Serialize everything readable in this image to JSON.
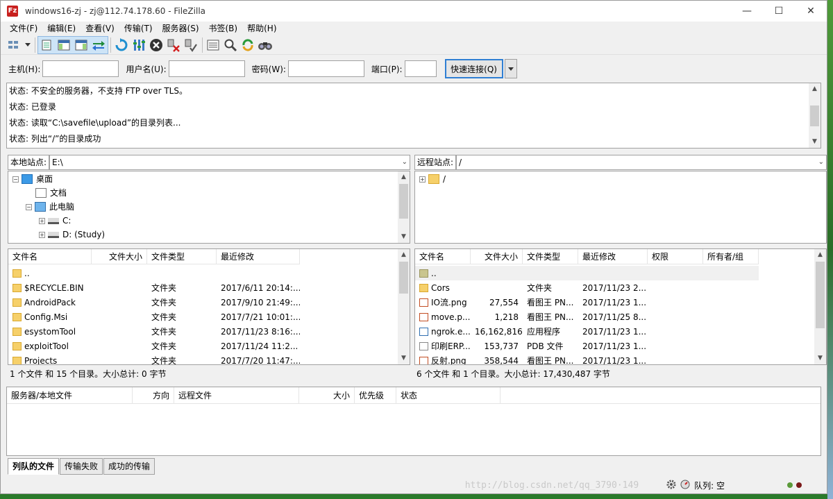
{
  "window": {
    "title": "windows16-zj - zj@112.74.178.60 - FileZilla",
    "app_icon": "Fz",
    "minimize": "—",
    "maximize": "☐",
    "close": "✕"
  },
  "menu": [
    "文件(F)",
    "编辑(E)",
    "查看(V)",
    "传输(T)",
    "服务器(S)",
    "书签(B)",
    "帮助(H)"
  ],
  "quickconnect": {
    "host_label": "主机(H):",
    "user_label": "用户名(U):",
    "pass_label": "密码(W):",
    "port_label": "端口(P):",
    "connect_label": "快速连接(Q)",
    "host_value": "",
    "user_value": "",
    "pass_value": "",
    "port_value": ""
  },
  "log": [
    "状态:  不安全的服务器，不支持 FTP over TLS。",
    "状态:  已登录",
    "状态:  读取“C:\\savefile\\upload”的目录列表...",
    "状态:  列出“/”的目录成功"
  ],
  "local": {
    "site_label": "本地站点:",
    "path": "E:\\",
    "tree": {
      "desktop": "桌面",
      "documents": "文档",
      "thispc": "此电脑",
      "c_drive": "C:",
      "d_drive": "D: (Study)"
    },
    "columns": [
      "文件名",
      "文件大小",
      "文件类型",
      "最近修改"
    ],
    "files": [
      {
        "name": "..",
        "size": "",
        "type": "",
        "modified": ""
      },
      {
        "name": "$RECYCLE.BIN",
        "size": "",
        "type": "文件夹",
        "modified": "2017/6/11 20:14:..."
      },
      {
        "name": "AndroidPack",
        "size": "",
        "type": "文件夹",
        "modified": "2017/9/10 21:49:..."
      },
      {
        "name": "Config.Msi",
        "size": "",
        "type": "文件夹",
        "modified": "2017/7/21 10:01:..."
      },
      {
        "name": "esystomTool",
        "size": "",
        "type": "文件夹",
        "modified": "2017/11/23 8:16:..."
      },
      {
        "name": "exploitTool",
        "size": "",
        "type": "文件夹",
        "modified": "2017/11/24 11:2..."
      },
      {
        "name": "Projects",
        "size": "",
        "type": "文件夹",
        "modified": "2017/7/20 11:47:..."
      }
    ],
    "status": "1 个文件 和 15 个目录。大小总计: 0 字节"
  },
  "remote": {
    "site_label": "远程站点:",
    "path": "/",
    "tree_root": "/",
    "columns": [
      "文件名",
      "文件大小",
      "文件类型",
      "最近修改",
      "权限",
      "所有者/组"
    ],
    "files": [
      {
        "name": "..",
        "size": "",
        "type": "",
        "modified": "",
        "icon": "parent"
      },
      {
        "name": "Cors",
        "size": "",
        "type": "文件夹",
        "modified": "2017/11/23 2...",
        "icon": "folder"
      },
      {
        "name": "IO流.png",
        "size": "27,554",
        "type": "看图王 PN...",
        "modified": "2017/11/23 1...",
        "icon": "png"
      },
      {
        "name": "move.p...",
        "size": "1,218",
        "type": "看图王 PN...",
        "modified": "2017/11/25 8...",
        "icon": "png"
      },
      {
        "name": "ngrok.e...",
        "size": "16,162,816",
        "type": "应用程序",
        "modified": "2017/11/23 1...",
        "icon": "exe"
      },
      {
        "name": "印刷ERP...",
        "size": "153,737",
        "type": "PDB 文件",
        "modified": "2017/11/23 1...",
        "icon": "file"
      },
      {
        "name": "反射.png",
        "size": "358,544",
        "type": "看图王 PN...",
        "modified": "2017/11/23 1...",
        "icon": "png"
      }
    ],
    "status": "6 个文件 和 1 个目录。大小总计: 17,430,487 字节"
  },
  "queue": {
    "columns": [
      "服务器/本地文件",
      "方向",
      "远程文件",
      "大小",
      "优先级",
      "状态"
    ],
    "tabs": [
      "列队的文件",
      "传输失败",
      "成功的传输"
    ]
  },
  "statusbar": {
    "queue_text": "队列: 空",
    "watermark": "http://blog.csdn.net/qq_3790·149"
  },
  "colors": {
    "selection_blue": "#cde4f7",
    "border": "#a0a0a0",
    "connect_border": "#2f7fd3"
  }
}
